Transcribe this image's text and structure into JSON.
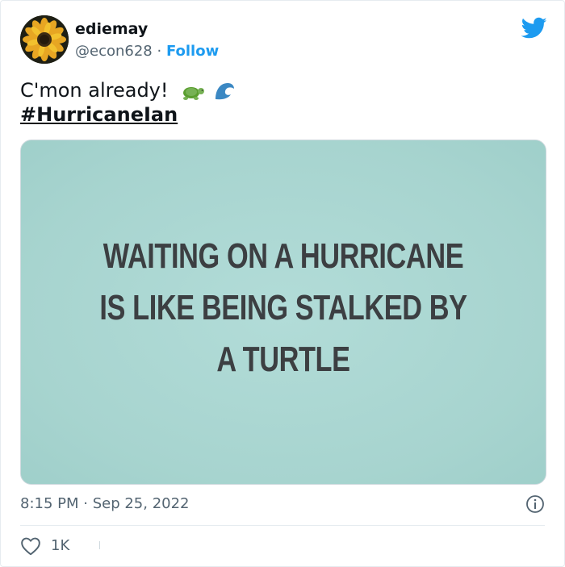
{
  "user": {
    "display_name": "ediemay",
    "handle": "@econ628",
    "separator": "·",
    "follow_label": "Follow"
  },
  "tweet": {
    "text": "C'mon already!",
    "hashtag": "#HurricaneIan",
    "emojis": [
      "turtle-emoji",
      "wave-emoji"
    ]
  },
  "media": {
    "lines": [
      "WAITING ON A HURRICANE",
      "IS LIKE BEING STALKED BY",
      "A TURTLE"
    ],
    "background_color": "#a9d7d3",
    "text_color": "#3c3f42"
  },
  "meta": {
    "timestamp": "8:15 PM · Sep 25, 2022"
  },
  "engagement": {
    "likes": "1K"
  },
  "colors": {
    "accent": "#1d9bf0",
    "text": "#0f1419",
    "muted": "#536471"
  }
}
